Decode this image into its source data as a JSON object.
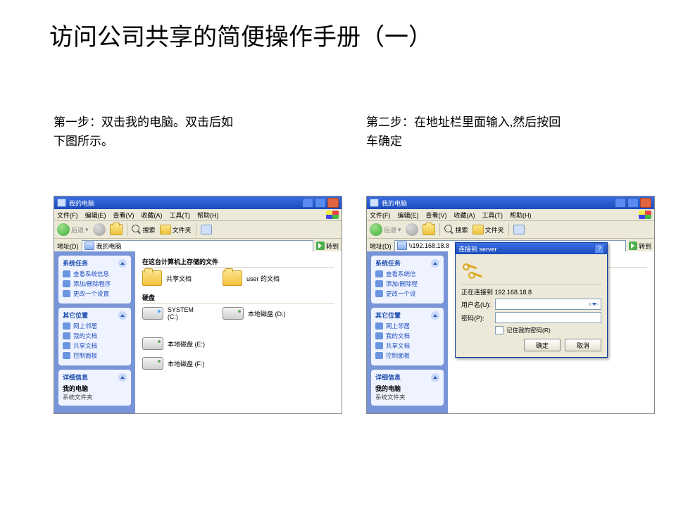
{
  "page_title": "访问公司共享的简便操作手册（一）",
  "step1_text": "第一步：双击我的电脑。双击后如下图所示。",
  "step2_text": "第二步：在地址栏里面输入,然后按回车确定",
  "win_title": "我的电脑",
  "menu": {
    "file": "文件(F)",
    "edit": "编辑(E)",
    "view": "查看(V)",
    "fav": "收藏(A)",
    "tools": "工具(T)",
    "help": "帮助(H)"
  },
  "toolbar": {
    "back": "后退",
    "search": "搜索",
    "folders": "文件夹"
  },
  "addr_label": "地址(D)",
  "go_label": "转到",
  "addr1_value": "我的电脑",
  "addr2_value": "\\\\192.168.18.8",
  "sidebar": {
    "sys_hd": "系统任务",
    "sys_items": [
      "查看系统信息",
      "添加/删除程序",
      "更改一个设置"
    ],
    "other_hd": "其它位置",
    "other_items": [
      "网上邻居",
      "我的文档",
      "共享文档",
      "控制面板"
    ],
    "detail_hd": "详细信息",
    "detail_title": "我的电脑",
    "detail_sub": "系统文件夹"
  },
  "sidebar2": {
    "sys_items": [
      "查看系统信",
      "添加/删除程",
      "更改一个设"
    ]
  },
  "content": {
    "files_hd": "在这台计算机上存储的文件",
    "shared_docs": "共享文档",
    "user_docs": "user 的文档",
    "drives_hd": "硬盘",
    "drive_c": "SYSTEM (C:)",
    "drive_d": "本地磁盘 (D:)",
    "drive_e": "本地磁盘 (E:)",
    "drive_f": "本地磁盘 (F:)"
  },
  "dialog": {
    "title": "连接到 server",
    "connecting": "正在连接到 192.168.18.8",
    "user_label": "用户名(U):",
    "pass_label": "密码(P):",
    "user_value": "",
    "remember": "记住我的密码(R)",
    "ok": "确定",
    "cancel": "取消"
  }
}
